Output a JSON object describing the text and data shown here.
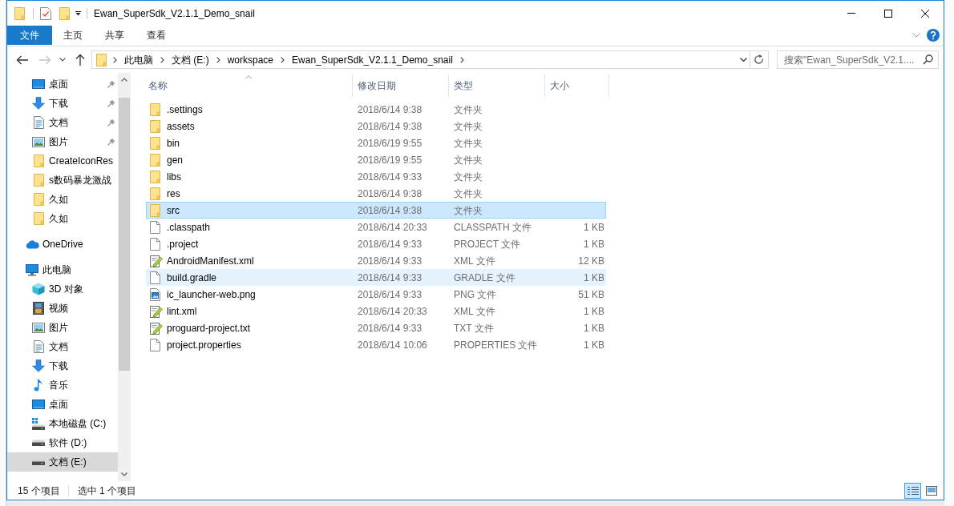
{
  "window": {
    "title": "Ewan_SuperSdk_V2.1.1_Demo_snail"
  },
  "ribbon": {
    "file_button": "文件",
    "tabs": [
      "主页",
      "共享",
      "查看"
    ]
  },
  "navigation": [
    {
      "kind": "back",
      "disabled": false
    },
    {
      "kind": "forward",
      "disabled": true
    },
    {
      "kind": "recent",
      "disabled": false
    },
    {
      "kind": "up",
      "disabled": false
    }
  ],
  "address_bar": {
    "path": [
      "此电脑",
      "文档 (E:)",
      "workspace",
      "Ewan_SuperSdk_V2.1.1_Demo_snail"
    ]
  },
  "search": {
    "placeholder": "搜索\"Ewan_SuperSdk_V2.1...."
  },
  "sidebar": {
    "quick_access": [
      {
        "label": "桌面",
        "kind": "desktop",
        "pinned": true,
        "selected": false
      },
      {
        "label": "下载",
        "kind": "download",
        "pinned": true,
        "selected": false
      },
      {
        "label": "文档",
        "kind": "document",
        "pinned": true,
        "selected": false
      },
      {
        "label": "图片",
        "kind": "picture",
        "pinned": true,
        "selected": false
      },
      {
        "label": "CreateIconRes",
        "kind": "folder",
        "pinned": false,
        "selected": false
      },
      {
        "label": "s数码暴龙激战",
        "kind": "folder",
        "pinned": false,
        "selected": false
      },
      {
        "label": "久如",
        "kind": "folder",
        "pinned": false,
        "selected": false
      },
      {
        "label": "久如",
        "kind": "folder",
        "pinned": false,
        "selected": false
      }
    ],
    "items": [
      {
        "label": "OneDrive",
        "kind": "cloud",
        "selected": false
      },
      {
        "label": "此电脑",
        "kind": "computer",
        "selected": false,
        "children": [
          {
            "label": "3D 对象",
            "kind": "cube",
            "selected": false
          },
          {
            "label": "视频",
            "kind": "video",
            "selected": false
          },
          {
            "label": "图片",
            "kind": "picture",
            "selected": false
          },
          {
            "label": "文档",
            "kind": "document",
            "selected": false
          },
          {
            "label": "下载",
            "kind": "download",
            "selected": false
          },
          {
            "label": "音乐",
            "kind": "music",
            "selected": false
          },
          {
            "label": "桌面",
            "kind": "desktop",
            "selected": false
          },
          {
            "label": "本地磁盘 (C:)",
            "kind": "system_drive",
            "selected": false
          },
          {
            "label": "软件 (D:)",
            "kind": "drive",
            "selected": false
          },
          {
            "label": "文档 (E:)",
            "kind": "drive",
            "selected": true
          }
        ]
      }
    ]
  },
  "table": {
    "columns": [
      {
        "label": "名称",
        "sorted": true
      },
      {
        "label": "修改日期",
        "sorted": false
      },
      {
        "label": "类型",
        "sorted": false
      },
      {
        "label": "大小",
        "sorted": false
      }
    ],
    "rows": [
      {
        "name": ".settings",
        "date": "2018/6/14 9:38",
        "type": "文件夹",
        "kind": "folder",
        "selected": false,
        "hovered": false
      },
      {
        "name": "assets",
        "date": "2018/6/14 9:38",
        "type": "文件夹",
        "kind": "folder",
        "selected": false,
        "hovered": false
      },
      {
        "name": "bin",
        "date": "2018/6/19 9:55",
        "type": "文件夹",
        "kind": "folder",
        "selected": false,
        "hovered": false
      },
      {
        "name": "gen",
        "date": "2018/6/19 9:55",
        "type": "文件夹",
        "kind": "folder",
        "selected": false,
        "hovered": false
      },
      {
        "name": "libs",
        "date": "2018/6/14 9:33",
        "type": "文件夹",
        "kind": "folder",
        "selected": false,
        "hovered": false
      },
      {
        "name": "res",
        "date": "2018/6/14 9:38",
        "type": "文件夹",
        "kind": "folder",
        "selected": false,
        "hovered": false
      },
      {
        "name": "src",
        "date": "2018/6/14 9:38",
        "type": "文件夹",
        "kind": "folder",
        "selected": true,
        "hovered": false
      },
      {
        "name": ".classpath",
        "date": "2018/6/14 20:33",
        "type": "CLASSPATH 文件",
        "size": "1 KB",
        "kind": "file",
        "selected": false,
        "hovered": false
      },
      {
        "name": ".project",
        "date": "2018/6/14 9:33",
        "type": "PROJECT 文件",
        "size": "1 KB",
        "kind": "file",
        "selected": false,
        "hovered": false
      },
      {
        "name": "AndroidManifest.xml",
        "date": "2018/6/14 9:33",
        "type": "XML 文件",
        "size": "12 KB",
        "kind": "notepad",
        "selected": false,
        "hovered": false
      },
      {
        "name": "build.gradle",
        "date": "2018/6/14 9:33",
        "type": "GRADLE 文件",
        "size": "1 KB",
        "kind": "file",
        "selected": false,
        "hovered": true
      },
      {
        "name": "ic_launcher-web.png",
        "date": "2018/6/14 9:33",
        "type": "PNG 文件",
        "size": "51 KB",
        "kind": "image",
        "selected": false,
        "hovered": false
      },
      {
        "name": "lint.xml",
        "date": "2018/6/14 20:33",
        "type": "XML 文件",
        "size": "1 KB",
        "kind": "notepad",
        "selected": false,
        "hovered": false
      },
      {
        "name": "proguard-project.txt",
        "date": "2018/6/14 9:33",
        "type": "TXT 文件",
        "size": "1 KB",
        "kind": "notepad",
        "selected": false,
        "hovered": false
      },
      {
        "name": "project.properties",
        "date": "2018/6/14 10:06",
        "type": "PROPERTIES 文件",
        "size": "1 KB",
        "kind": "file",
        "selected": false,
        "hovered": false
      }
    ]
  },
  "status_bar": {
    "item_count": "15 个项目",
    "selection": "选中 1 个项目",
    "views": [
      {
        "kind": "details",
        "selected": true
      },
      {
        "kind": "large_icons",
        "selected": false
      }
    ]
  }
}
